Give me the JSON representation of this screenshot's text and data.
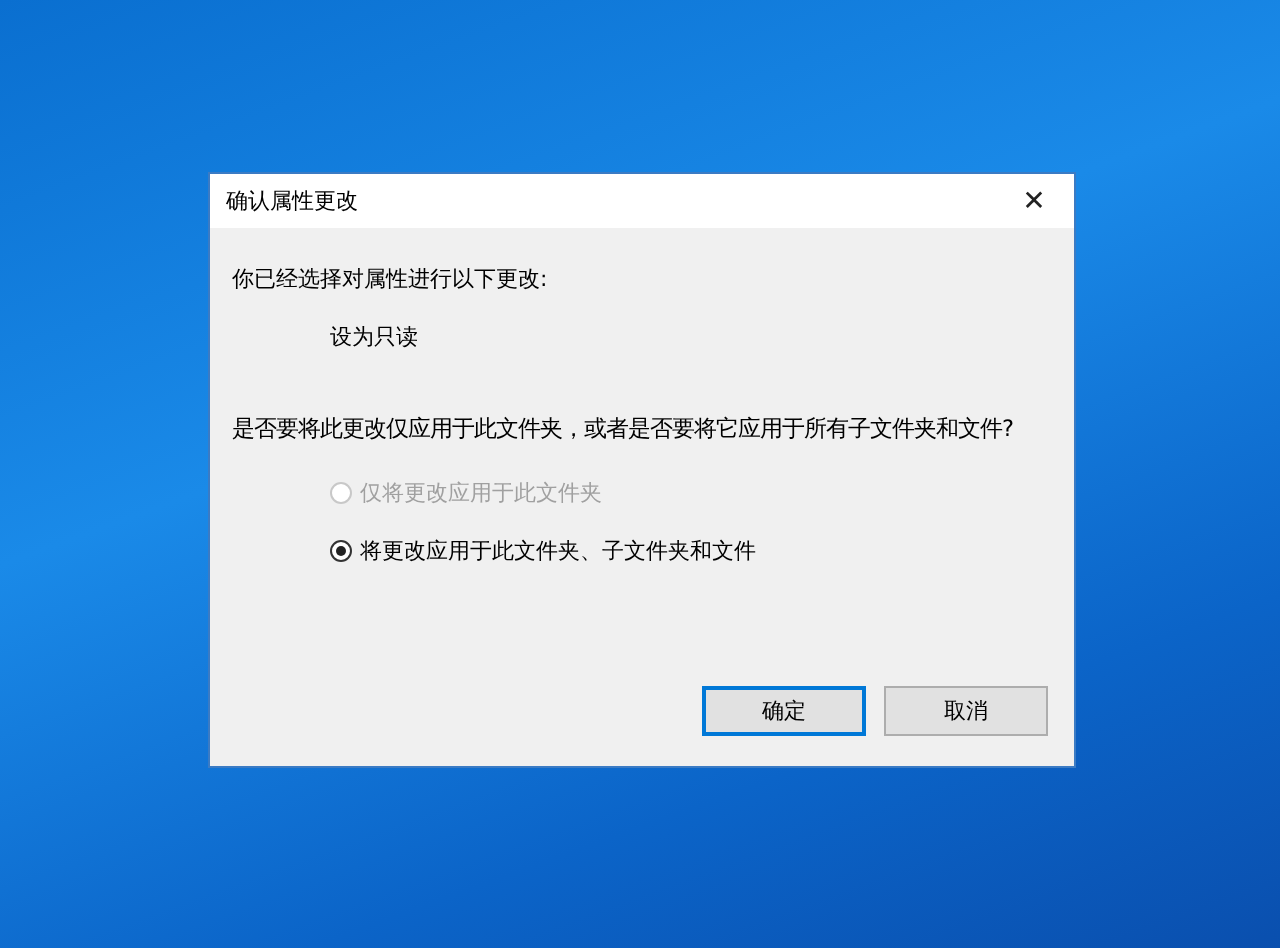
{
  "window": {
    "title": "确认属性更改",
    "close": "✕"
  },
  "intro": "你已经选择对属性进行以下更改:",
  "changes": [
    "设为只读"
  ],
  "question": "是否要将此更改仅应用于此文件夹，或者是否要将它应用于所有子文件夹和文件?",
  "options": [
    {
      "label": "仅将更改应用于此文件夹",
      "selected": false,
      "disabled": true
    },
    {
      "label": "将更改应用于此文件夹、子文件夹和文件",
      "selected": true,
      "disabled": false
    }
  ],
  "buttons": [
    {
      "label": "确定",
      "default": true
    },
    {
      "label": "取消",
      "default": false
    }
  ]
}
